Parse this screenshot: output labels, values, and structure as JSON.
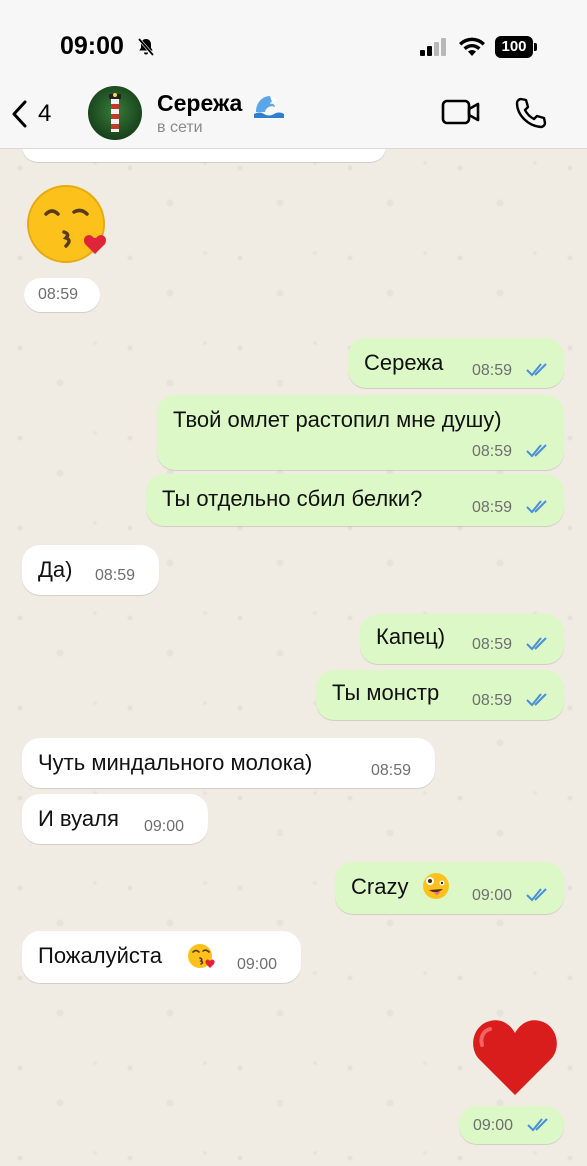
{
  "status_bar": {
    "time": "09:00",
    "battery": "100"
  },
  "header": {
    "back_count": "4",
    "contact_name": "Сережа",
    "contact_status": "в сети"
  },
  "messages": [
    {
      "direction": "in",
      "time": "08:59",
      "text": "",
      "emoji": "kissing-face-with-heart"
    },
    {
      "direction": "out",
      "text": "Сережа",
      "time": "08:59",
      "read": true
    },
    {
      "direction": "out",
      "text": "Твой омлет растопил мне душу)",
      "time": "08:59",
      "read": true
    },
    {
      "direction": "out",
      "text": "Ты отдельно сбил белки?",
      "time": "08:59",
      "read": true
    },
    {
      "direction": "in",
      "text": "Да)",
      "time": "08:59"
    },
    {
      "direction": "out",
      "text": "Капец)",
      "time": "08:59",
      "read": true
    },
    {
      "direction": "out",
      "text": "Ты монстр",
      "time": "08:59",
      "read": true
    },
    {
      "direction": "in",
      "text": "Чуть миндального молока)",
      "time": "08:59"
    },
    {
      "direction": "in",
      "text": "И вуаля",
      "time": "09:00"
    },
    {
      "direction": "out",
      "text": "Crazy",
      "time": "09:00",
      "read": true,
      "emoji": "zany-face"
    },
    {
      "direction": "in",
      "text": "Пожалуйста",
      "time": "09:00",
      "emoji": "kissing-face-with-heart"
    },
    {
      "direction": "out",
      "text": "",
      "time": "09:00",
      "read": true,
      "emoji": "red-heart"
    }
  ],
  "partial_top_time": "08:59",
  "colors": {
    "outgoing_bubble": "#dbf8c6",
    "incoming_bubble": "#ffffff",
    "read_ticks": "#4a90d9",
    "wallpaper": "#f1ece3"
  }
}
